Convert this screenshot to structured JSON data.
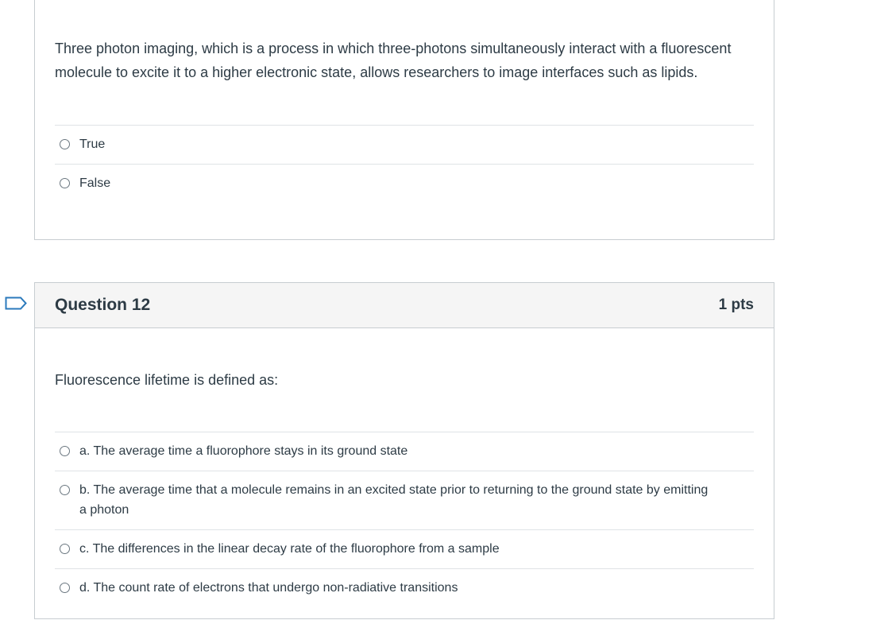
{
  "q11": {
    "text": "Three photon imaging, which is a process in which three-photons simultaneously interact with a fluorescent molecule to excite it to a higher electronic state, allows researchers to image interfaces such as lipids.",
    "answers": [
      "True",
      "False"
    ]
  },
  "q12": {
    "title": "Question 12",
    "points": "1 pts",
    "text": "Fluorescence lifetime is defined as:",
    "answers": [
      "a. The average time a fluorophore stays in its ground state",
      "b. The average time that a molecule remains in an excited state prior to returning to the ground state by emitting a photon",
      "c. The differences in the linear decay rate of the fluorophore from a sample",
      "d. The count rate of electrons that undergo non-radiative transitions"
    ]
  },
  "icons": {
    "flag": "flag-question-icon",
    "radio": "radio-unchecked-icon"
  },
  "colors": {
    "text": "#2d3b45",
    "border": "#c7cdd1",
    "header_bg": "#f5f5f5",
    "divider": "#dfe3e6",
    "flag_stroke": "#2b7abc"
  }
}
